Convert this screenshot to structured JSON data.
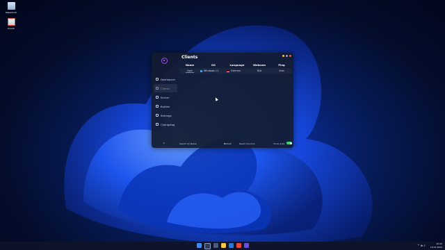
{
  "desktop": {
    "icons": [
      {
        "label": "Papierkorb",
        "icon": "recycle-bin-icon"
      },
      {
        "label": "Unlock",
        "icon": "cleanup-icon"
      }
    ]
  },
  "app": {
    "title": "Clients",
    "accent": "#a44bf5",
    "sidebar": [
      {
        "label": "Dashboard",
        "icon": "home-icon",
        "active": false
      },
      {
        "label": "Clients",
        "icon": "clients-icon",
        "active": true
      },
      {
        "label": "Server",
        "icon": "server-icon",
        "active": false
      },
      {
        "label": "Builder",
        "icon": "builder-icon",
        "active": false
      },
      {
        "label": "Settings",
        "icon": "gear-icon",
        "active": false
      },
      {
        "label": "Changelog",
        "icon": "changelog-icon",
        "active": false
      }
    ],
    "table": {
      "columns": [
        "Name",
        "OS",
        "Language",
        "Webcam",
        "Ping"
      ],
      "rows": [
        {
          "name": "User",
          "os": "Windows 11",
          "language": "German",
          "webcam": "N/A",
          "ping": "0ms"
        }
      ]
    },
    "footer": {
      "search": "Search by Name",
      "refresh": "Refresh",
      "reset": "Reset Columns",
      "show_alias": "Show Alias",
      "show_alias_on": true,
      "toggle_color": "#3cd36f"
    }
  },
  "taskbar": {
    "time": "10:22",
    "date": "19.07.2024",
    "tray": "^ ⊕ ♪"
  }
}
